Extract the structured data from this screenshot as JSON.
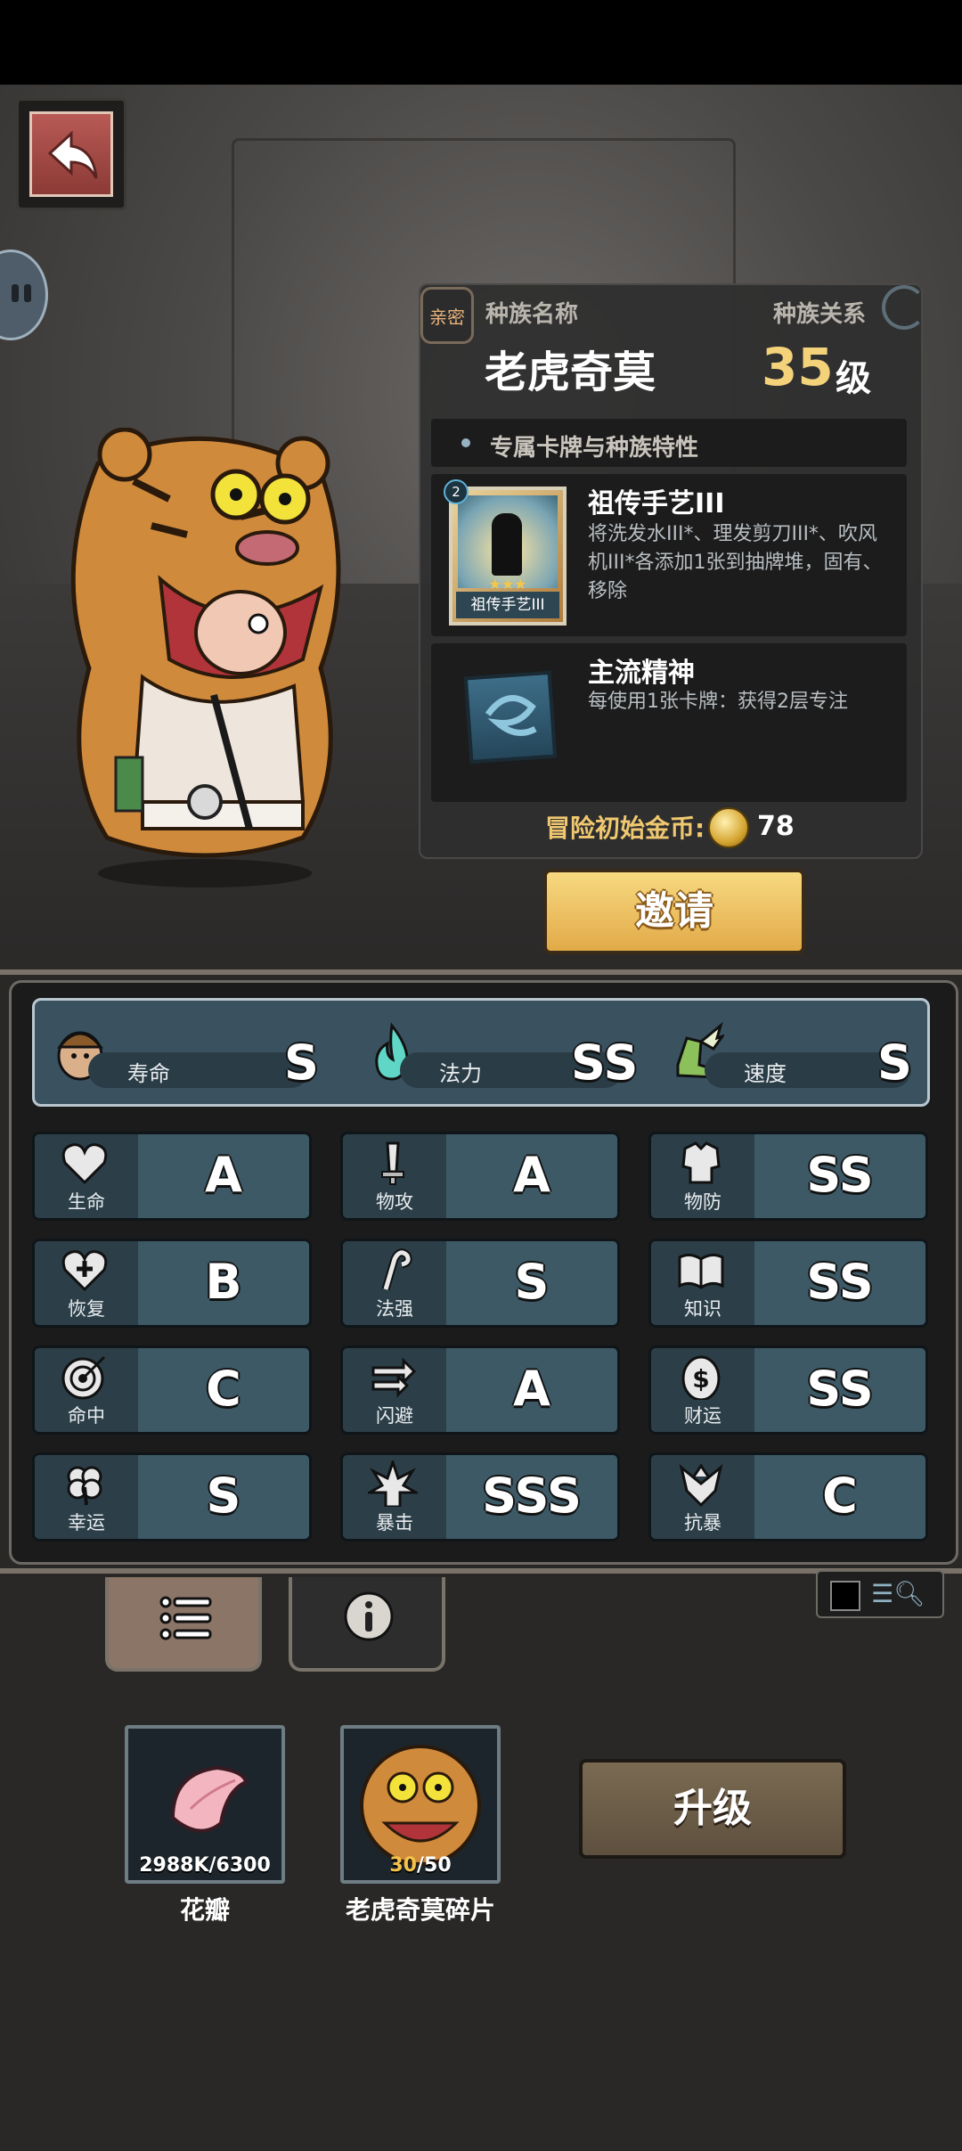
{
  "race": {
    "affinity_badge": "亲密",
    "name_label": "种族名称",
    "relation_label": "种族关系",
    "name": "老虎奇莫",
    "level_value": "35",
    "level_suffix": "级"
  },
  "traits": {
    "section_title": "专属卡牌与种族特性",
    "cards": [
      {
        "title": "祖传手艺III",
        "desc": "将洗发水III*、理发剪刀III*、吹风机III*各添加1张到抽牌堆，固有、移除",
        "card_caption": "祖传手艺III",
        "badge": "2",
        "stars": "★★★"
      },
      {
        "title": "主流精神",
        "desc": "每使用1张卡牌：获得2层专注"
      }
    ]
  },
  "gold": {
    "label": "冒险初始金币:",
    "value": "78"
  },
  "invite_label": "邀请",
  "top_stats": [
    {
      "name": "寿命",
      "grade": "S",
      "icon": "lifespan-icon"
    },
    {
      "name": "法力",
      "grade": "SS",
      "icon": "mana-flame-icon"
    },
    {
      "name": "速度",
      "grade": "S",
      "icon": "winged-boot-icon"
    }
  ],
  "stats": [
    {
      "name": "生命",
      "grade": "A",
      "icon": "heart-icon"
    },
    {
      "name": "物攻",
      "grade": "A",
      "icon": "sword-icon"
    },
    {
      "name": "物防",
      "grade": "SS",
      "icon": "armor-icon"
    },
    {
      "name": "恢复",
      "grade": "B",
      "icon": "heart-plus-icon"
    },
    {
      "name": "法强",
      "grade": "S",
      "icon": "staff-icon"
    },
    {
      "name": "知识",
      "grade": "SS",
      "icon": "book-icon"
    },
    {
      "name": "命中",
      "grade": "C",
      "icon": "target-icon"
    },
    {
      "name": "闪避",
      "grade": "A",
      "icon": "dodge-arrows-icon"
    },
    {
      "name": "财运",
      "grade": "SS",
      "icon": "coin-icon"
    },
    {
      "name": "幸运",
      "grade": "S",
      "icon": "clover-icon"
    },
    {
      "name": "暴击",
      "grade": "SSS",
      "icon": "burst-icon"
    },
    {
      "name": "抗暴",
      "grade": "C",
      "icon": "shield-burst-icon"
    }
  ],
  "materials": [
    {
      "name": "花瓣",
      "count": "2988K/6300"
    },
    {
      "name": "老虎奇莫碎片",
      "count_have": "30",
      "count_need": "/50"
    }
  ],
  "upgrade_label": "升级",
  "colors": {
    "accent_gold": "#f4d27a",
    "stat_cell": "#3d5966",
    "panel": "#2e2e2e"
  }
}
